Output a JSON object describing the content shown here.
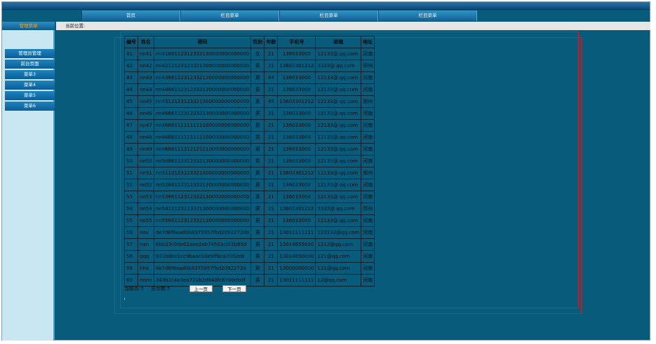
{
  "top_nav": [
    "首页",
    "栏目菜单",
    "栏目菜单",
    "栏目菜单"
  ],
  "left": {
    "title": "管理菜单",
    "items": [
      "管理员管理",
      "前台页面",
      "菜单3",
      "菜单4",
      "菜单5",
      "菜单6"
    ]
  },
  "breadcrumb": "当前位置:",
  "table": {
    "headers": [
      "编号",
      "姓名",
      "密码",
      "性别",
      "年龄",
      "手机号",
      "邮箱",
      "地址"
    ],
    "rows": [
      [
        "41",
        "nn41",
        "nn4166112312332130000000000000",
        "女",
        "21",
        "136033000",
        "12133@.qq.com",
        "河南"
      ],
      [
        "42",
        "nn42",
        "nn4212123123321300000000000000",
        "男",
        "21",
        "13603301212",
        "3333@.qq.com",
        "郑州"
      ],
      [
        "43",
        "nn43",
        "nn4366112312332130000000000000",
        "男",
        "44",
        "136033000",
        "12133@.qq.com",
        "河南"
      ],
      [
        "44",
        "nn44",
        "nn4466112312332130000000000000",
        "男",
        "21",
        "136033000",
        "12133@.qq.com",
        "河南"
      ],
      [
        "45",
        "nn45",
        "nn4512123123321300000000000000",
        "男",
        "45",
        "13603301212",
        "12133@.qq.com",
        "郑州"
      ],
      [
        "46",
        "nn46",
        "nn4666112312332130000000000000",
        "男",
        "21",
        "136033000",
        "12133@.qq.com",
        "河南"
      ],
      [
        "47",
        "nn47",
        "nn4666111111111100000000000000",
        "男",
        "21",
        "136033000",
        "12133@.qq.com",
        "河南"
      ],
      [
        "48",
        "nn48",
        "nn4666111111111100000000000000",
        "男",
        "21",
        "136033000",
        "12133@.qq.com",
        "河南"
      ],
      [
        "49",
        "nn49",
        "nn4666111212121210000000000000",
        "男",
        "21",
        "136033000",
        "12133@.qq.com",
        "河南"
      ],
      [
        "50",
        "nn50",
        "nn5066112312332130000000000000",
        "男",
        "21",
        "136033000",
        "12133@.qq.com",
        "河南"
      ],
      [
        "51",
        "nn51",
        "nn5112123123321300000000000000",
        "男",
        "21",
        "13603301212",
        "12133@.qq.com",
        "郑州"
      ],
      [
        "52",
        "nn52",
        "nn5266112312332130000000000000",
        "男",
        "21",
        "136033000",
        "12133@.qq.com",
        "河南"
      ],
      [
        "53",
        "nn53",
        "nn5366112312332130000000000000",
        "男",
        "21",
        "136033000",
        "12133@.qq.com",
        "河南"
      ],
      [
        "54",
        "nn54",
        "nn5412123123321300000000000000",
        "男",
        "21",
        "13603301212",
        "3333@.qq.com",
        "郑州"
      ],
      [
        "55",
        "nn55",
        "nn5566112312332130000000000000",
        "男",
        "21",
        "136033000",
        "12133@.qq.com",
        "河南"
      ],
      [
        "56",
        "nov",
        "de7d6f6aad0b8375957fbd2092272db",
        "男",
        "21",
        "13011111111",
        "123132@qq.com",
        "河南"
      ],
      [
        "57",
        "nan",
        "6bb33c90e02aee2eb74503cbf2b89d",
        "男",
        "21",
        "13014655610",
        "1212@qq.com",
        "河南"
      ],
      [
        "58",
        "qqq",
        "931bd0e1cc9baae10e9ff6ca7002e8",
        "男",
        "21",
        "13014650000",
        "121@qq.com",
        "河南"
      ],
      [
        "59",
        "hhx",
        "de7d6f6aad0b8375957fbd2092272d",
        "男",
        "21",
        "13000000000",
        "121@qq.com",
        "河南"
      ],
      [
        "60",
        "nnnn",
        "343b1c4a3ea721b2d640fc8700db0f",
        "男",
        "21",
        "13011111111",
        "12@qq.com",
        "河南"
      ]
    ]
  },
  "pager": {
    "current": "当前页:3",
    "total": "总页数:5",
    "prev": "上一页",
    "next": "下一页"
  }
}
